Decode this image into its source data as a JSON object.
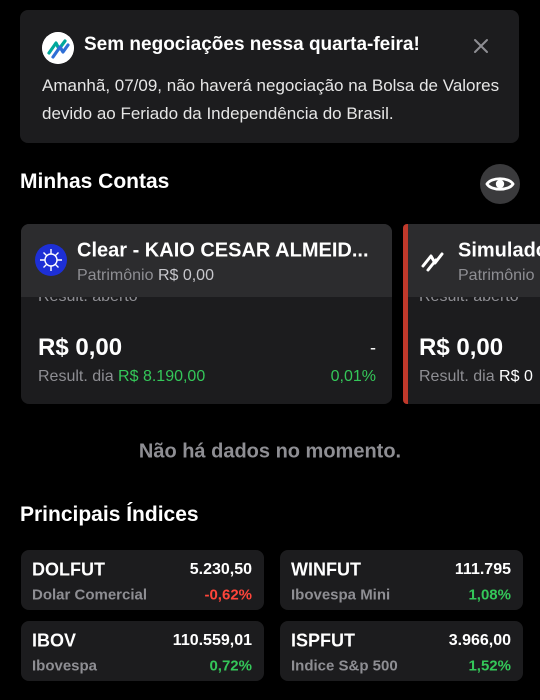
{
  "notice": {
    "title": "Sem negociações nessa quarta-feira!",
    "body": "Amanhã, 07/09, não haverá negociação na Bolsa de Valores devido ao Feriado da Independência do Brasil.",
    "icon": "app-logo-icon",
    "close_icon": "close-icon"
  },
  "accounts": {
    "title": "Minhas Contas",
    "eye_icon": "eye-icon",
    "cards": [
      {
        "name": "Clear - KAIO CESAR ALMEID...",
        "patrimonio_label": "Patrimônio",
        "patrimonio_value": "R$ 0,00",
        "open_label": "Result. aberto",
        "open_value": "R$ 0,00",
        "open_change": "-",
        "day_label": "Result. dia",
        "day_value": "R$ 8.190,00",
        "day_pct": "0,01%"
      },
      {
        "name": "Simulado",
        "patrimonio_label": "Patrimônio",
        "open_label": "Result. aberto",
        "open_value": "R$ 0,00",
        "day_label": "Result. dia",
        "day_value": "R$ 0"
      }
    ]
  },
  "no_data": "Não há dados no momento.",
  "indices": {
    "title": "Principais Índices",
    "items": [
      {
        "symbol": "DOLFUT",
        "price": "5.230,50",
        "name": "Dolar Comercial",
        "change": "-0,62%",
        "direction": "down"
      },
      {
        "symbol": "WINFUT",
        "price": "111.795",
        "name": "Ibovespa Mini",
        "change": "1,08%",
        "direction": "up"
      },
      {
        "symbol": "IBOV",
        "price": "110.559,01",
        "name": "Ibovespa",
        "change": "0,72%",
        "direction": "up"
      },
      {
        "symbol": "ISPFUT",
        "price": "3.966,00",
        "name": "Indice S&p 500",
        "change": "1,52%",
        "direction": "up"
      }
    ]
  },
  "colors": {
    "background": "#000000",
    "card": "#1c1c1e",
    "positive": "#34c759",
    "negative": "#ff453a",
    "simulated_accent": "#c0392b"
  }
}
